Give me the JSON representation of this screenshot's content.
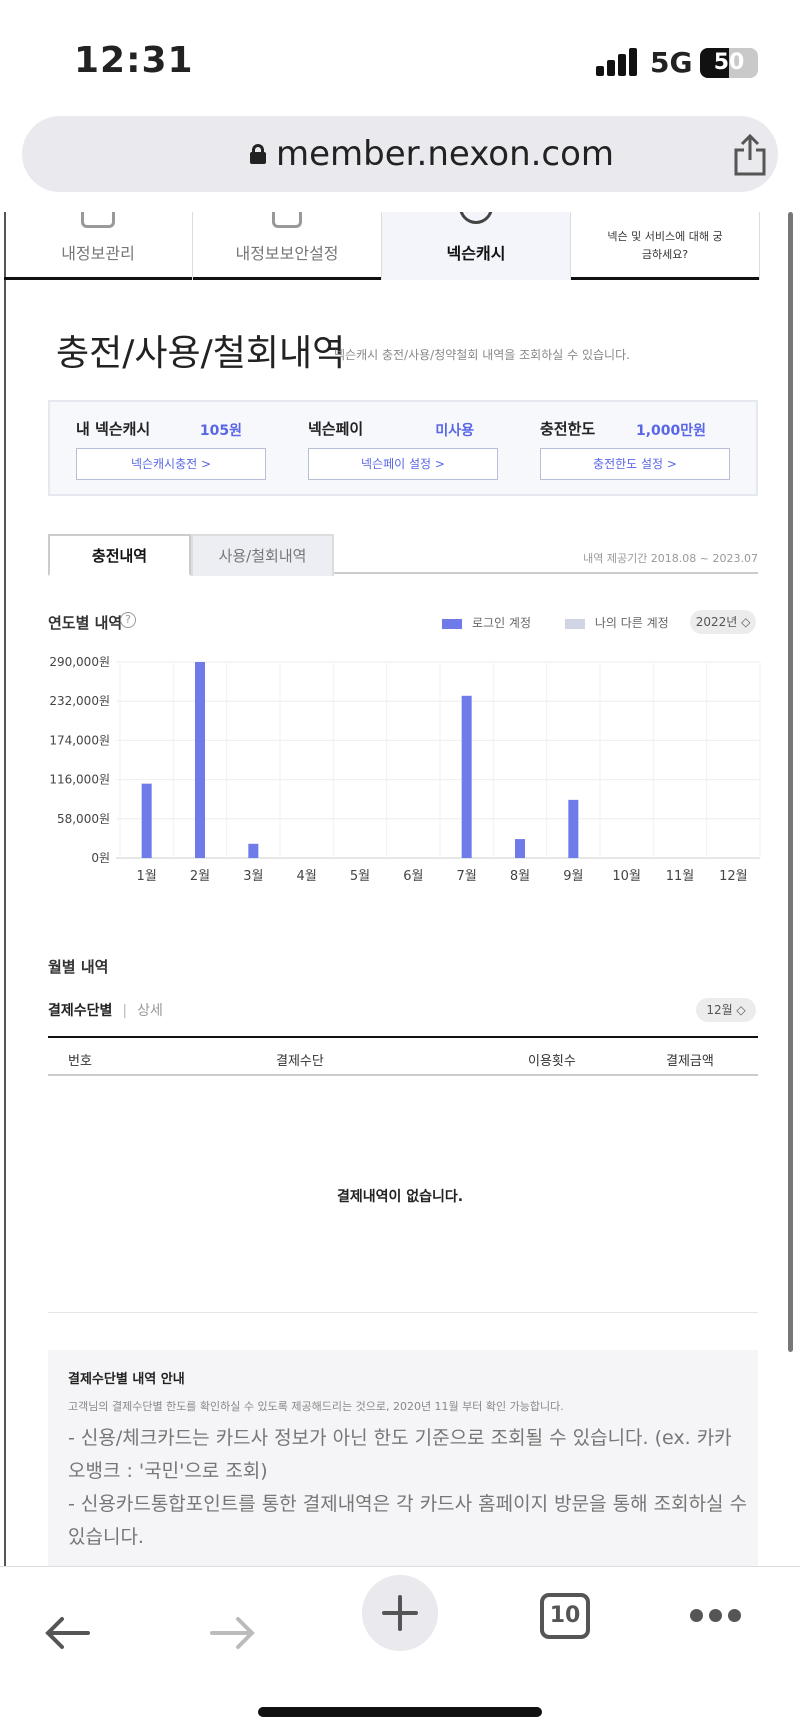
{
  "status_bar": {
    "time": "12:31",
    "network": "5G",
    "battery": "50"
  },
  "browser": {
    "url": "member.nexon.com"
  },
  "top_nav": [
    {
      "label": "내정보관리"
    },
    {
      "label": "내정보보안설정"
    },
    {
      "label": "넥슨캐시"
    },
    {
      "label": "넥슨 및 서비스에 대해 궁금하세요?"
    }
  ],
  "page": {
    "title": "충전/사용/철회내역",
    "description": "넥슨캐시 충전/사용/청약철회 내역을 조회하실 수 있습니다."
  },
  "summary": [
    {
      "label": "내 넥슨캐시",
      "value": "105원",
      "button": "넥슨캐시충전 >"
    },
    {
      "label": "넥슨페이",
      "value": "미사용",
      "button": "넥슨페이 설정 >"
    },
    {
      "label": "충전한도",
      "value": "1,000만원",
      "button": "충전한도 설정 >"
    }
  ],
  "tabs": {
    "active": "충전내역",
    "inactive": "사용/철회내역",
    "period": "내역 제공기간 2018.08 ~ 2023.07"
  },
  "yearly": {
    "title": "연도별 내역",
    "help": "?",
    "legend": [
      {
        "label": "로그인 계정",
        "color": "#6f7be8"
      },
      {
        "label": "나의 다른 계정",
        "color": "#d1d4e2"
      }
    ],
    "year": "2022년 ◇"
  },
  "chart_data": {
    "type": "bar",
    "categories": [
      "1월",
      "2월",
      "3월",
      "4월",
      "5월",
      "6월",
      "7월",
      "8월",
      "9월",
      "10월",
      "11월",
      "12월"
    ],
    "series": [
      {
        "name": "로그인 계정",
        "values": [
          110000,
          290000,
          21000,
          0,
          0,
          0,
          240000,
          28000,
          86000,
          0,
          0,
          0
        ]
      }
    ],
    "y_ticks": [
      "290,000원",
      "232,000원",
      "174,000원",
      "116,000원",
      "58,000원",
      "0원"
    ],
    "ylim": [
      0,
      290000
    ],
    "grid": true,
    "bar_color": "#6f7be8"
  },
  "monthly": {
    "title": "월별 내역",
    "sub_tab_active": "결제수단별",
    "sub_tab_sep": "|",
    "sub_tab_inactive": "상세",
    "month": "12월 ◇",
    "columns": [
      "번호",
      "결제수단",
      "이용횟수",
      "결제금액"
    ],
    "empty": "결제내역이 없습니다."
  },
  "info": {
    "title": "결제수단별 내역 안내",
    "desc": "고객님의 결제수단별 한도를 확인하실 수 있도록 제공해드리는 것으로, 2020년 11월 부터 확인 가능합니다.",
    "lines": [
      "- 신용/체크카드는 카드사 정보가 아닌 한도 기준으로 조회될 수 있습니다. (ex. 카카오뱅크 : '국민'으로 조회)",
      "- 신용카드통합포인트를 통한 결제내역은 각 카드사 홈페이지 방문을 통해 조회하실 수 있습니다."
    ]
  },
  "toolbar": {
    "tab_count": "10"
  }
}
